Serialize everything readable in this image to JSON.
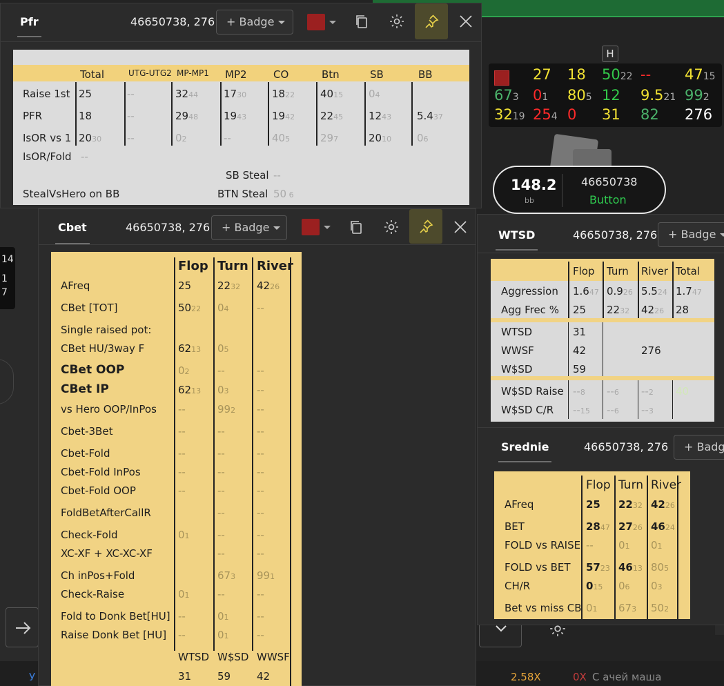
{
  "pfr_panel": {
    "title": "Pfr",
    "player_id": "46650738, 276",
    "badge_label": "+ Badge",
    "columns": [
      "Total",
      "UTG-UTG2",
      "MP-MP1",
      "MP2",
      "CO",
      "Btn",
      "SB",
      "BB"
    ],
    "rows": [
      {
        "label": "Raise 1st",
        "cells": [
          [
            "25",
            ""
          ],
          [
            "--",
            ""
          ],
          [
            "32",
            "44"
          ],
          [
            "17",
            "30"
          ],
          [
            "18",
            "22"
          ],
          [
            "40",
            "15"
          ],
          [
            "0",
            "4"
          ],
          [
            "",
            ""
          ]
        ]
      },
      {
        "label": "PFR",
        "cells": [
          [
            "18",
            ""
          ],
          [
            "--",
            ""
          ],
          [
            "29",
            "48"
          ],
          [
            "19",
            "43"
          ],
          [
            "19",
            "42"
          ],
          [
            "22",
            "45"
          ],
          [
            "12",
            "43"
          ],
          [
            "5.4",
            "37"
          ]
        ]
      },
      {
        "label": "IsOR vs 1",
        "cells": [
          [
            "20",
            "30"
          ],
          [
            "--",
            ""
          ],
          [
            "0",
            "2"
          ],
          [
            "--",
            ""
          ],
          [
            "40",
            "5"
          ],
          [
            "29",
            "7"
          ],
          [
            "20",
            "10"
          ],
          [
            "0",
            "6"
          ]
        ]
      }
    ],
    "isor_fold_label": "IsOR/Fold",
    "isor_fold_value": "--",
    "sb_steal_label": "SB Steal",
    "sb_steal_value": "--",
    "steal_vs_hero_label": "StealVsHero on BB",
    "btn_steal_label": "BTN Steal",
    "btn_steal_value": "50",
    "btn_steal_count": "6"
  },
  "hud": {
    "rows": [
      [
        {
          "v": "",
          "c": "swatch"
        },
        {
          "v": "27",
          "c": "y"
        },
        {
          "v": "18",
          "c": "y"
        },
        {
          "v": "50",
          "s": "22",
          "c": "gr"
        },
        {
          "v": "--",
          "c": "rd"
        },
        {
          "v": "47",
          "s": "15",
          "c": "y"
        }
      ],
      [
        {
          "v": "67",
          "s": "3",
          "c": "dg"
        },
        {
          "v": "0",
          "s": "1",
          "c": "rd"
        },
        {
          "v": "80",
          "s": "5",
          "c": "y"
        },
        {
          "v": "12",
          "c": "gr"
        },
        {
          "v": "9.5",
          "s": "21",
          "c": "y"
        },
        {
          "v": "99",
          "s": "2",
          "c": "dg"
        }
      ],
      [
        {
          "v": "32",
          "s": "19",
          "c": "y"
        },
        {
          "v": "25",
          "s": "4",
          "c": "rd"
        },
        {
          "v": "0",
          "c": "rd"
        },
        {
          "v": "31",
          "c": "y"
        },
        {
          "v": "82",
          "c": "dg"
        },
        {
          "v": "276",
          "c": "w"
        }
      ]
    ],
    "stack": "148.2",
    "stack_unit": "bb",
    "seat_id": "46650738",
    "position": "Button",
    "h_icon": "H"
  },
  "cbet_panel": {
    "title": "Cbet",
    "player_id": "46650738, 276",
    "badge_label": "+ Badge",
    "columns": [
      "Flop",
      "Turn",
      "River"
    ],
    "rows": [
      {
        "label": "AFreq",
        "cells": [
          [
            "25",
            ""
          ],
          [
            "22",
            "32"
          ],
          [
            "42",
            "26"
          ]
        ]
      },
      {
        "label": "CBet [TOT]",
        "cells": [
          [
            "50",
            "22"
          ],
          [
            "0",
            "4"
          ],
          [
            "--",
            ""
          ]
        ]
      },
      {
        "label": "Single raised pot:",
        "cells": [
          [
            "",
            ""
          ],
          [
            "",
            ""
          ],
          [
            "",
            ""
          ]
        ]
      },
      {
        "label": "CBet HU/3way F",
        "cells": [
          [
            "62",
            "13"
          ],
          [
            "0",
            "5"
          ],
          [
            "",
            ""
          ]
        ]
      },
      {
        "label": "CBet OOP",
        "big": true,
        "cells": [
          [
            "0",
            "2"
          ],
          [
            "--",
            ""
          ],
          [
            "--",
            ""
          ]
        ]
      },
      {
        "label": "CBet IP",
        "big": true,
        "cells": [
          [
            "62",
            "13"
          ],
          [
            "0",
            "3"
          ],
          [
            "--",
            ""
          ]
        ]
      },
      {
        "label": "vs Hero OOP/InPos",
        "cells": [
          [
            "--",
            ""
          ],
          [
            "99",
            "2"
          ],
          [
            "--",
            ""
          ]
        ]
      },
      {
        "label": "Cbet-3Bet",
        "cells": [
          [
            "--",
            ""
          ],
          [
            "--",
            ""
          ],
          [
            "--",
            ""
          ]
        ]
      },
      {
        "label": "Cbet-Fold",
        "cells": [
          [
            "--",
            ""
          ],
          [
            "--",
            ""
          ],
          [
            "--",
            ""
          ]
        ]
      },
      {
        "label": "Cbet-Fold InPos",
        "cells": [
          [
            "--",
            ""
          ],
          [
            "--",
            ""
          ],
          [
            "--",
            ""
          ]
        ]
      },
      {
        "label": "Cbet-Fold OOP",
        "cells": [
          [
            "--",
            ""
          ],
          [
            "--",
            ""
          ],
          [
            "--",
            ""
          ]
        ]
      },
      {
        "label": "FoldBetAfterCallR",
        "cells": [
          [
            "",
            ""
          ],
          [
            "--",
            ""
          ],
          [
            "--",
            ""
          ]
        ]
      },
      {
        "label": "Check-Fold",
        "cells": [
          [
            "0",
            "1"
          ],
          [
            "--",
            ""
          ],
          [
            "--",
            ""
          ]
        ]
      },
      {
        "label": "XC-XF + XC-XC-XF",
        "cells": [
          [
            "",
            ""
          ],
          [
            "--",
            ""
          ],
          [
            "--",
            ""
          ]
        ]
      },
      {
        "label": "Ch inPos+Fold",
        "cells": [
          [
            "",
            ""
          ],
          [
            "67",
            "3"
          ],
          [
            "99",
            "1"
          ]
        ]
      },
      {
        "label": "Check-Raise",
        "cells": [
          [
            "0",
            "1"
          ],
          [
            "--",
            ""
          ],
          [
            "--",
            ""
          ]
        ]
      },
      {
        "label": "Fold to Donk Bet[HU]",
        "cells": [
          [
            "--",
            ""
          ],
          [
            "0",
            "1"
          ],
          [
            "--",
            ""
          ]
        ]
      },
      {
        "label": "Raise Donk Bet [HU]",
        "cells": [
          [
            "--",
            ""
          ],
          [
            "0",
            "1"
          ],
          [
            "--",
            ""
          ]
        ]
      }
    ],
    "footer_labels": [
      "WTSD",
      "W$SD",
      "WWSF"
    ],
    "footer_values": [
      "31",
      "59",
      "42"
    ]
  },
  "wtsd_panel": {
    "title": "WTSD",
    "player_id": "46650738, 276",
    "badge_label": "+ Badge",
    "columns": [
      "Flop",
      "Turn",
      "River",
      "Total"
    ],
    "rows1": [
      {
        "label": "Aggression",
        "cells": [
          [
            "1.6",
            "47"
          ],
          [
            "0.9",
            "26"
          ],
          [
            "5.5",
            "24"
          ],
          [
            "1.7",
            "47"
          ]
        ]
      },
      {
        "label": "Agg Frec %",
        "cells": [
          [
            "25",
            ""
          ],
          [
            "22",
            "32"
          ],
          [
            "42",
            "26"
          ],
          [
            "28",
            ""
          ]
        ]
      }
    ],
    "wtsd_label": "WTSD",
    "wtsd_value": "31",
    "wwsf_label": "WWSF",
    "wwsf_value": "42",
    "wwsf_hands": "276",
    "wsd_label": "W$SD",
    "wsd_value": "59",
    "rows3": [
      {
        "label": "W$SD Raise",
        "cells": [
          [
            "--",
            "8"
          ],
          [
            "--",
            "6"
          ],
          [
            "--",
            "2"
          ],
          [
            "40",
            ""
          ]
        ]
      },
      {
        "label": "W$SD C/R",
        "cells": [
          [
            "--",
            "15"
          ],
          [
            "--",
            "6"
          ],
          [
            "--",
            "3"
          ],
          [
            "",
            ""
          ]
        ]
      }
    ]
  },
  "srednie_panel": {
    "title": "Srednie",
    "player_id": "46650738, 276",
    "badge_label": "+ Badge",
    "columns": [
      "Flop",
      "Turn",
      "River"
    ],
    "rows": [
      {
        "label": "AFreq",
        "cells": [
          [
            "25",
            ""
          ],
          [
            "22",
            "32"
          ],
          [
            "42",
            "26"
          ]
        ]
      },
      {
        "label": "BET",
        "cells": [
          [
            "28",
            "47"
          ],
          [
            "27",
            "26"
          ],
          [
            "46",
            "24"
          ]
        ]
      },
      {
        "label": "FOLD vs RAISE",
        "cells": [
          [
            "--",
            ""
          ],
          [
            "0",
            "1"
          ],
          [
            "0",
            "1"
          ]
        ]
      },
      {
        "label": "FOLD vs BET",
        "cells": [
          [
            "57",
            "23"
          ],
          [
            "46",
            "13"
          ],
          [
            "80",
            "5"
          ]
        ]
      },
      {
        "label": "CH/R",
        "cells": [
          [
            "0",
            "15"
          ],
          [
            "0",
            "6"
          ],
          [
            "0",
            "3"
          ]
        ]
      },
      {
        "label": "Bet vs miss CB",
        "cells": [
          [
            "0",
            "1"
          ],
          [
            "67",
            "3"
          ],
          [
            "50",
            "2"
          ]
        ]
      }
    ]
  },
  "background": {
    "left_numbers": [
      "14",
      "1",
      "7"
    ],
    "bottom_left": "У",
    "bottom_mid1": "2.58X",
    "bottom_mid2": "0X",
    "bottom_mid3": "С ачей маша"
  }
}
